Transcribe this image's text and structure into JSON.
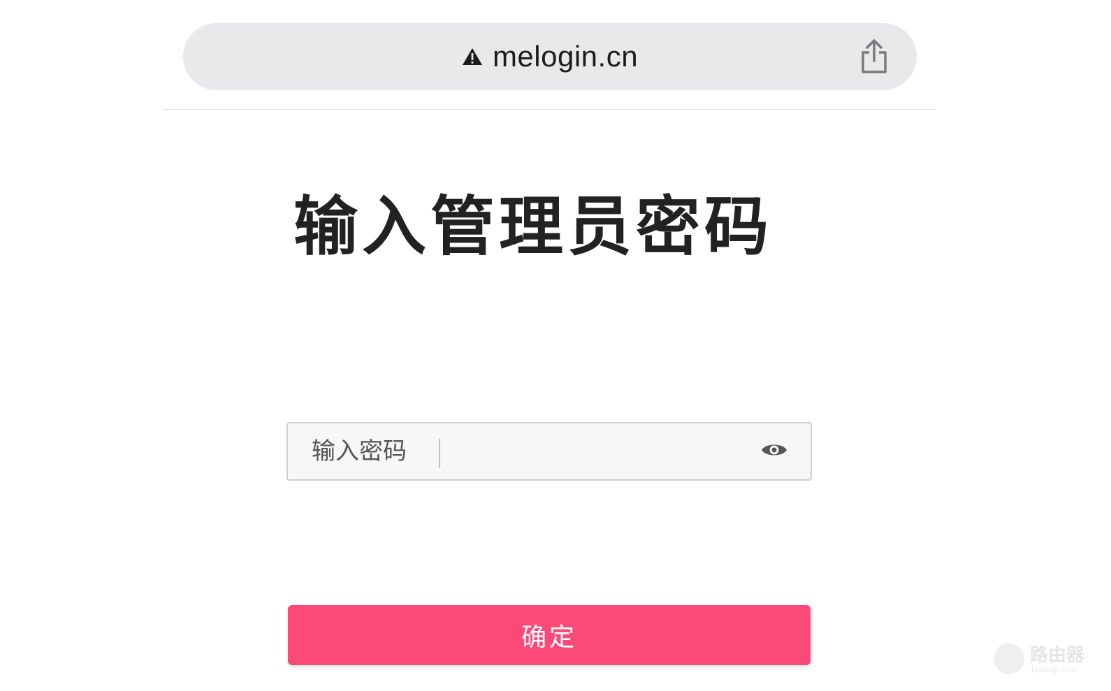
{
  "browser": {
    "url": "melogin.cn",
    "security_icon": "warning-triangle-icon",
    "share_icon": "share-icon"
  },
  "page": {
    "title": "输入管理员密码"
  },
  "password_field": {
    "label": "输入密码",
    "value": "",
    "toggle_icon": "eye-icon"
  },
  "confirm_button": {
    "label": "确定"
  },
  "watermark": {
    "text": "路由器",
    "subtext": "luyouqi.com"
  },
  "colors": {
    "accent": "#fb4a77",
    "address_bar_bg": "#e9e9eb",
    "title_text": "#222222"
  }
}
